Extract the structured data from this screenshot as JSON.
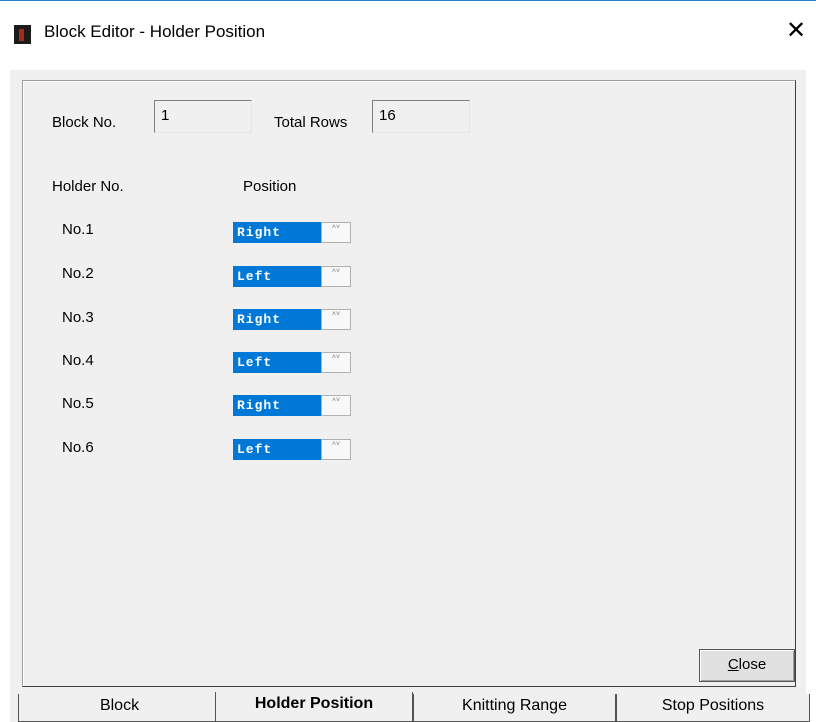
{
  "window": {
    "title": "Block Editor - Holder Position",
    "close_glyph": "✕"
  },
  "block": {
    "block_no_label": "Block No.",
    "block_no_value": "1",
    "total_rows_label": "Total Rows",
    "total_rows_value": "16"
  },
  "headers": {
    "holder_no": "Holder No.",
    "position": "Position"
  },
  "holders": [
    {
      "name": "No.1",
      "position": "Right"
    },
    {
      "name": "No.2",
      "position": "Left"
    },
    {
      "name": "No.3",
      "position": "Right"
    },
    {
      "name": "No.4",
      "position": "Left"
    },
    {
      "name": "No.5",
      "position": "Right"
    },
    {
      "name": "No.6",
      "position": "Left"
    }
  ],
  "spin_arrows": "˄˅",
  "buttons": {
    "close_mnemonic": "C",
    "close_rest": "lose"
  },
  "tabs": [
    {
      "label": "Block",
      "active": false
    },
    {
      "label": "Holder Position",
      "active": true
    },
    {
      "label": "Knitting Range",
      "active": false
    },
    {
      "label": "Stop Positions",
      "active": false
    }
  ],
  "colors": {
    "selection_blue": "#0078d7",
    "dialog_bg": "#f0f0f0",
    "title_accent": "#2d7dd2"
  }
}
